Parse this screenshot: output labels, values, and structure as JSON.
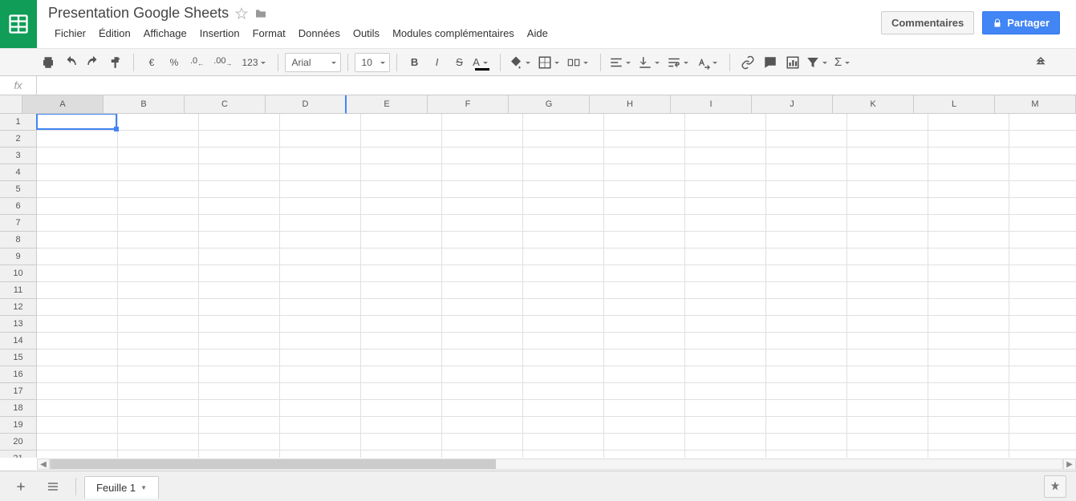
{
  "doc": {
    "title": "Presentation Google Sheets"
  },
  "menu": {
    "file": "Fichier",
    "edit": "Édition",
    "view": "Affichage",
    "insert": "Insertion",
    "format": "Format",
    "data": "Données",
    "tools": "Outils",
    "addons": "Modules complémentaires",
    "help": "Aide"
  },
  "header": {
    "comments": "Commentaires",
    "share": "Partager"
  },
  "toolbar": {
    "currency": "€",
    "percent": "%",
    "dec_dec": ".0",
    "inc_dec": ".00",
    "num_fmt": "123",
    "font": "Arial",
    "size": "10"
  },
  "fx": {
    "label": "fx",
    "value": ""
  },
  "grid": {
    "cols": [
      "A",
      "B",
      "C",
      "D",
      "E",
      "F",
      "G",
      "H",
      "I",
      "J",
      "K",
      "L",
      "M"
    ],
    "rows_count": 21,
    "active": "A1"
  },
  "tabs": {
    "sheet1": "Feuille 1"
  }
}
